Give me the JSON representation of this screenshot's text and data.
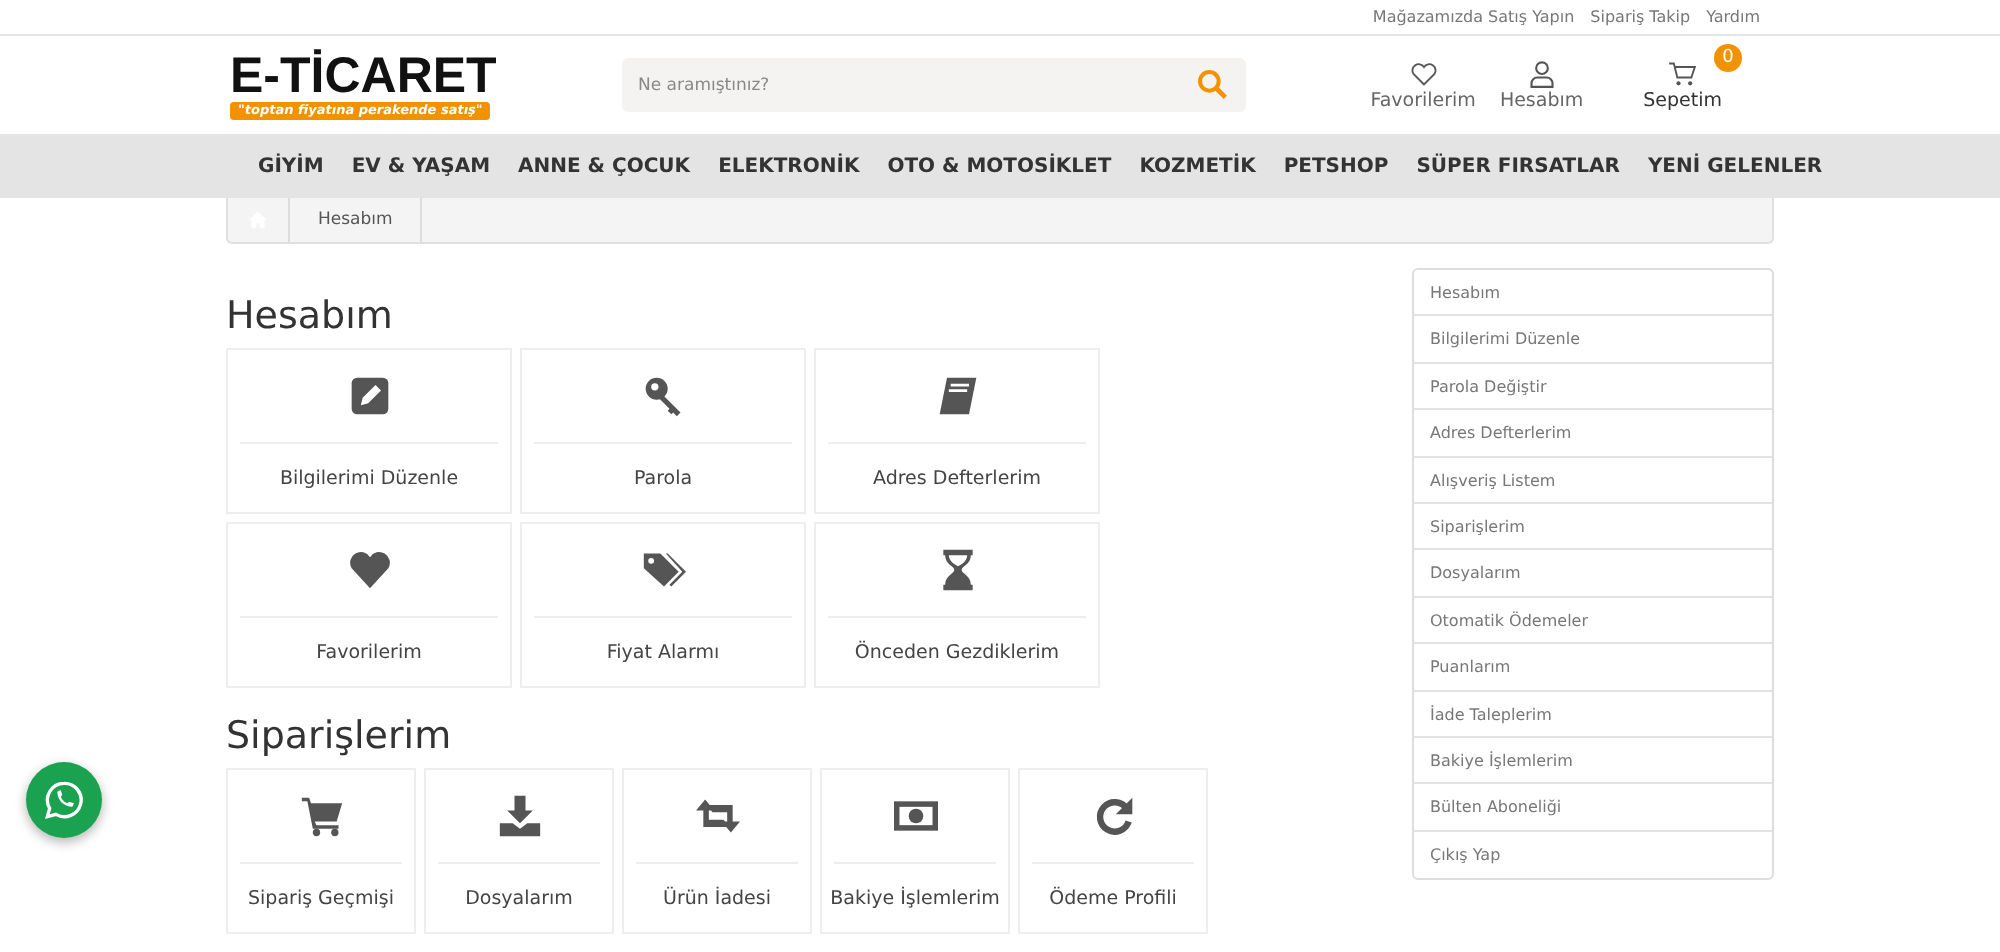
{
  "top_links": [
    "Mağazamızda Satış Yapın",
    "Sipariş Takip",
    "Yardım"
  ],
  "logo": {
    "name": "E-TİCARET",
    "tagline": "\"toptan fiyatına perakende satış\""
  },
  "search": {
    "placeholder": "Ne aramıştınız?"
  },
  "header_actions": [
    {
      "label": "Favorilerim"
    },
    {
      "label": "Hesabım"
    },
    {
      "label": "Sepetim",
      "badge": "0"
    }
  ],
  "nav": [
    "GİYİM",
    "EV & YAŞAM",
    "ANNE & ÇOCUK",
    "ELEKTRONİK",
    "OTO & MOTOSİKLET",
    "KOZMETİK",
    "PETSHOP",
    "SÜPER FIRSATLAR",
    "YENİ GELENLER"
  ],
  "breadcrumb": [
    "Hesabım"
  ],
  "sections": [
    {
      "title": "Hesabım",
      "cards": [
        {
          "label": "Bilgilerimi Düzenle"
        },
        {
          "label": "Parola"
        },
        {
          "label": "Adres Defterlerim"
        },
        {
          "label": "Favorilerim"
        },
        {
          "label": "Fiyat Alarmı"
        },
        {
          "label": "Önceden Gezdiklerim"
        }
      ]
    },
    {
      "title": "Siparişlerim",
      "cards": [
        {
          "label": "Sipariş Geçmişi"
        },
        {
          "label": "Dosyalarım"
        },
        {
          "label": "Ürün İadesi"
        },
        {
          "label": "Bakiye İşlemlerim"
        },
        {
          "label": "Ödeme Profili"
        }
      ]
    }
  ],
  "sidebar": {
    "items": [
      "Hesabım",
      "Bilgilerimi Düzenle",
      "Parola Değiştir",
      "Adres Defterlerim",
      "Alışveriş Listem",
      "Siparişlerim",
      "Dosyalarım",
      "Otomatik Ödemeler",
      "Puanlarım",
      "İade Taleplerim",
      "Bakiye İşlemlerim",
      "Bülten Aboneliği",
      "Çıkış Yap"
    ]
  }
}
